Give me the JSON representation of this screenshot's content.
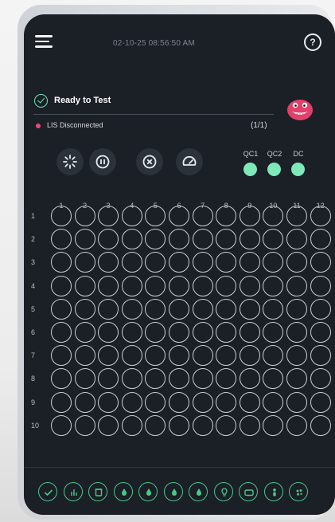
{
  "header": {
    "datetime": "02-10-25 08:56:50 AM",
    "menu_icon": "hamburger-menu-icon",
    "help_label": "?"
  },
  "status": {
    "text": "Ready to Test",
    "icon": "check-circle-icon",
    "lis_text": "LIS Disconnected",
    "lis_color": "#e84a7a",
    "count": "(1/1)"
  },
  "controls": [
    "spinner-icon",
    "pause-icon",
    "cancel-icon",
    "speedometer-icon"
  ],
  "qc": {
    "labels": [
      "QC1",
      "QC2",
      "DC"
    ],
    "color": "#7ee8b8"
  },
  "plate": {
    "columns": [
      "1",
      "2",
      "3",
      "4",
      "5",
      "6",
      "7",
      "8",
      "9",
      "10",
      "11",
      "12"
    ],
    "rows": [
      "1",
      "2",
      "3",
      "4",
      "5",
      "6",
      "7",
      "8",
      "9",
      "10"
    ]
  },
  "toolbar": {
    "icons": [
      "check-icon",
      "bars-icon",
      "trash-icon",
      "drop-icon",
      "drop-icon",
      "drop-icon",
      "drop-icon",
      "bulb-icon",
      "display-icon",
      "person-icon",
      "palette-icon"
    ],
    "accent": "#49c88a"
  }
}
